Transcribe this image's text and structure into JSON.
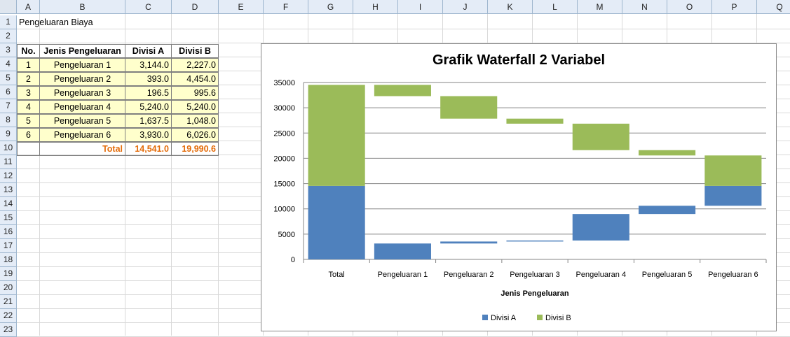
{
  "columns": [
    "A",
    "B",
    "C",
    "D",
    "E",
    "F",
    "G",
    "H",
    "I",
    "J",
    "K",
    "L",
    "M",
    "N",
    "O",
    "P",
    "Q"
  ],
  "rows": [
    "1",
    "2",
    "3",
    "4",
    "5",
    "6",
    "7",
    "8",
    "9",
    "10",
    "11",
    "12",
    "13",
    "14",
    "15",
    "16",
    "17",
    "18",
    "19",
    "20",
    "21",
    "22",
    "23"
  ],
  "sheet": {
    "title": "Pengeluaran Biaya",
    "headers": {
      "no": "No.",
      "jenis": "Jenis Pengeluaran",
      "a": "Divisi A",
      "b": "Divisi B"
    },
    "rows": [
      {
        "no": "1",
        "jenis": "Pengeluaran 1",
        "a": "3,144.0",
        "b": "2,227.0"
      },
      {
        "no": "2",
        "jenis": "Pengeluaran 2",
        "a": "393.0",
        "b": "4,454.0"
      },
      {
        "no": "3",
        "jenis": "Pengeluaran 3",
        "a": "196.5",
        "b": "995.6"
      },
      {
        "no": "4",
        "jenis": "Pengeluaran 4",
        "a": "5,240.0",
        "b": "5,240.0"
      },
      {
        "no": "5",
        "jenis": "Pengeluaran 5",
        "a": "1,637.5",
        "b": "1,048.0"
      },
      {
        "no": "6",
        "jenis": "Pengeluaran 6",
        "a": "3,930.0",
        "b": "6,026.0"
      }
    ],
    "total": {
      "label": "Total",
      "a": "14,541.0",
      "b": "19,990.6"
    }
  },
  "chart_data": {
    "type": "bar",
    "subtype": "stacked waterfall",
    "title": "Grafik Waterfall 2 Variabel",
    "xlabel": "Jenis Pengeluaran",
    "ylabel": "",
    "ylim": [
      0,
      35000
    ],
    "yticks": [
      0,
      5000,
      10000,
      15000,
      20000,
      25000,
      30000,
      35000
    ],
    "grid": true,
    "legend_position": "bottom",
    "categories": [
      "Total",
      "Pengeluaran 1",
      "Pengeluaran 2",
      "Pengeluaran 3",
      "Pengeluaran 4",
      "Pengeluaran 5",
      "Pengeluaran 6"
    ],
    "series": [
      {
        "name": "Divisi A",
        "color": "#4f81bd",
        "segments": [
          [
            0,
            14541
          ],
          [
            0,
            3144
          ],
          [
            3144,
            3537
          ],
          [
            3537,
            3733.5
          ],
          [
            3733.5,
            8973.5
          ],
          [
            8973.5,
            10611
          ],
          [
            10611,
            14541
          ]
        ]
      },
      {
        "name": "Divisi B",
        "color": "#9bbb59",
        "segments": [
          [
            14541,
            34531.6
          ],
          [
            32304.6,
            34531.6
          ],
          [
            27850.6,
            32304.6
          ],
          [
            26855,
            27850.6
          ],
          [
            21615,
            26855
          ],
          [
            20567,
            21615
          ],
          [
            14541,
            20567
          ]
        ]
      }
    ]
  }
}
